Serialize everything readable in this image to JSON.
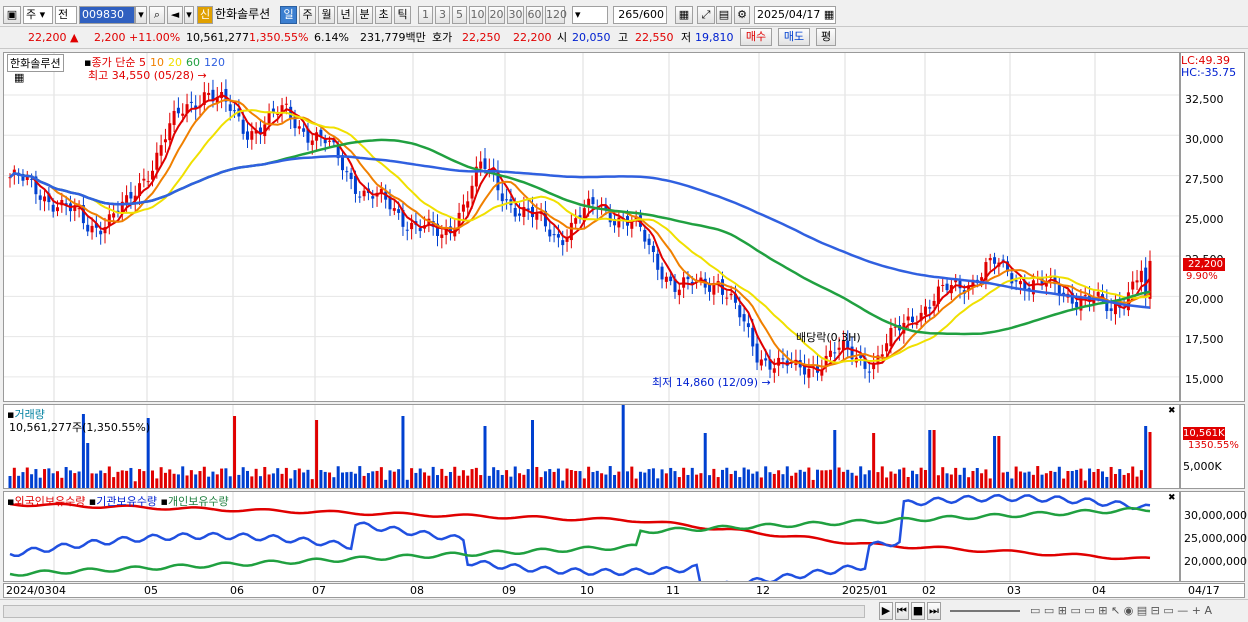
{
  "toolbar": {
    "market": "주",
    "prev_label": "전",
    "stock_code": "009830",
    "stock_name": "한화솔루션",
    "credit_badge": "신",
    "periods": [
      "일",
      "주",
      "월",
      "년",
      "분",
      "초",
      "틱"
    ],
    "active_period": "일",
    "intervals": [
      "1",
      "3",
      "5",
      "10",
      "20",
      "30",
      "60",
      "120"
    ],
    "count_value": "265",
    "count_total": "/600",
    "date_value": "2025/04/17"
  },
  "quote": {
    "price": "22,200",
    "arrow": "▲",
    "change": "2,200",
    "change_pct": "+11.00%",
    "volume": "10,561,277",
    "volume_pct": "1,350.55%",
    "turnover": "6.14%",
    "amount": "231,779백만",
    "hoga_label": "호가",
    "ask": "22,250",
    "bid": "22,200",
    "open_label": "시",
    "open": "20,050",
    "high_label": "고",
    "high": "22,550",
    "low_label": "저",
    "low": "19,810",
    "buy_label": "매수",
    "sell_label": "매도",
    "avg_label": "평"
  },
  "price_panel": {
    "stock_label": "한화솔루션",
    "ma_title": "종가 단순",
    "ma_periods": [
      "5",
      "10",
      "20",
      "60",
      "120"
    ],
    "max_label": "최고 34,550 (05/28)",
    "min_label": "최저 14,860 (12/09)",
    "dividend_label": "배당락(0,3H)",
    "lc_label": "LC:49.39",
    "hc_label": "HC:-35.75",
    "y_ticks": [
      "32,500",
      "30,000",
      "27,500",
      "25,000",
      "22,500",
      "20,000",
      "17,500",
      "15,000"
    ],
    "last_price_box": "22,200",
    "last_pct": "9.90%"
  },
  "volume_panel": {
    "title": "거래량",
    "value": "10,561,277주(1,350.55%)",
    "last_box": "10,561K",
    "last_pct": "1350.55%",
    "tick": "5,000K"
  },
  "holding_panel": {
    "legend": [
      "외국인보유수량",
      "기관보유수량",
      "개인보유수량"
    ],
    "y_ticks": [
      "30,000,000",
      "25,000,000",
      "20,000,000"
    ]
  },
  "date_axis": {
    "labels": [
      "2024/03",
      "04",
      "05",
      "06",
      "07",
      "08",
      "09",
      "10",
      "11",
      "12",
      "2025/01",
      "02",
      "03",
      "04"
    ],
    "right_label": "04/17"
  },
  "colors": {
    "up": "#e00000",
    "down": "#0040d0",
    "ma5": "#e00000",
    "ma10": "#f08000",
    "ma20": "#f0e000",
    "ma60": "#20a040",
    "ma120": "#3060e0"
  },
  "chart_data": {
    "type": "candlestick",
    "title": "한화솔루션",
    "ylim": [
      14000,
      34800
    ],
    "close_path": [
      {
        "x": "2024/03",
        "y": 27400
      },
      {
        "x": "04",
        "y": 26200
      },
      {
        "x": "04m",
        "y": 24300
      },
      {
        "x": "05",
        "y": 25500
      },
      {
        "x": "05m",
        "y": 30200
      },
      {
        "x": "05/28",
        "y": 33000
      },
      {
        "x": "06",
        "y": 30300
      },
      {
        "x": "06m",
        "y": 31400
      },
      {
        "x": "07",
        "y": 29500
      },
      {
        "x": "07m",
        "y": 26500
      },
      {
        "x": "08",
        "y": 25000
      },
      {
        "x": "08m",
        "y": 23500
      },
      {
        "x": "08e",
        "y": 28000
      },
      {
        "x": "09",
        "y": 25200
      },
      {
        "x": "09m",
        "y": 23800
      },
      {
        "x": "10",
        "y": 25800
      },
      {
        "x": "10m",
        "y": 24000
      },
      {
        "x": "11",
        "y": 20300
      },
      {
        "x": "11m",
        "y": 21200
      },
      {
        "x": "12",
        "y": 16500
      },
      {
        "x": "12/09",
        "y": 15300
      },
      {
        "x": "12m",
        "y": 16500
      },
      {
        "x": "2025/01",
        "y": 16000
      },
      {
        "x": "01m",
        "y": 19000
      },
      {
        "x": "02",
        "y": 20500
      },
      {
        "x": "02m",
        "y": 21900
      },
      {
        "x": "03",
        "y": 20800
      },
      {
        "x": "03m",
        "y": 20200
      },
      {
        "x": "04",
        "y": 19100
      },
      {
        "x": "04/17",
        "y": 22200
      }
    ]
  }
}
